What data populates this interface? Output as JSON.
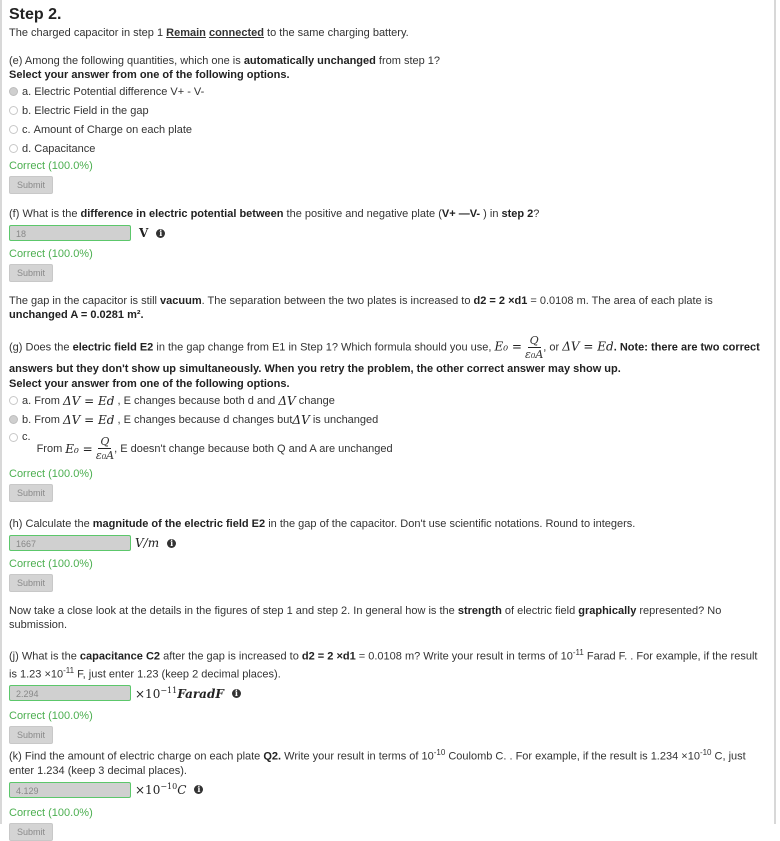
{
  "step": {
    "title": "Step 2.",
    "intro_prefix": "The charged capacitor in step 1 ",
    "intro_remain": "Remain",
    "intro_connected": "connected",
    "intro_suffix": " to the same charging battery."
  },
  "q_e": {
    "prefix": "(e) Among the following quantities, which one is ",
    "bold": "automatically unchanged",
    "suffix": " from step 1?",
    "instruction": "Select your answer from one of the following options.",
    "options": [
      {
        "letter": "a.",
        "text": "Electric Potential difference V+ - V-",
        "checked": true
      },
      {
        "letter": "b.",
        "text": "Electric Field in the gap",
        "checked": false
      },
      {
        "letter": "c.",
        "text": "Amount of Charge on each plate",
        "checked": false
      },
      {
        "letter": "d.",
        "text": "Capacitance",
        "checked": false
      }
    ],
    "status": "Correct (100.0%)",
    "submit_label": "Submit"
  },
  "q_f": {
    "prefix": "(f) What is the ",
    "bold1": "difference in electric potential between",
    "middle": " the positive and negative plate (",
    "bold2": "V+ —V-",
    "middle2": " ) in ",
    "bold3": "step 2",
    "suffix": "?",
    "value": "18",
    "unit": "V",
    "status": "Correct (100.0%)",
    "submit_label": "Submit"
  },
  "info_gap": {
    "t1": "The gap in the capacitor is still ",
    "b1": "vacuum",
    "t2": ". The separation between the two plates is increased to ",
    "b2": "d2 = 2 ×d1",
    "t3": " = 0.0108 m. The area of each plate is ",
    "b3": "unchanged A = 0.0281 m²."
  },
  "q_g": {
    "prefix": "(g) Does the ",
    "bold1": "electric field E2",
    "middle": " in the gap change from E1 in Step 1? Which formula should you use, ",
    "formula1_lhs": "E₀ =",
    "formula1_num": "Q",
    "formula1_den": "ε₀A",
    "or_text": ", or ",
    "formula2": "ΔV = Ed",
    "note": ". Note: there are two correct answers but they don't show up simultaneously. When you retry the problem, the other correct answer may show up.",
    "instruction": "Select your answer from one of the following options.",
    "options": [
      {
        "letter": "a.",
        "from": "From",
        "formula": "ΔV = Ed",
        "text": ", E changes because both d and ",
        "formula_b": "ΔV",
        "text2": " change",
        "checked": false
      },
      {
        "letter": "b.",
        "from": "From",
        "formula": "ΔV = Ed",
        "text": ", E changes because d changes but ",
        "formula_b": "ΔV",
        "text2": " is unchanged",
        "checked": true
      },
      {
        "letter": "c.",
        "from": "From",
        "formula_lhs": "E₀ =",
        "formula_num": "Q",
        "formula_den": "ε₀A",
        "text": ", E doesn't change because both Q and A are unchanged",
        "checked": false
      }
    ],
    "status": "Correct (100.0%)",
    "submit_label": "Submit"
  },
  "q_h": {
    "prefix": "(h) Calculate the ",
    "bold": "magnitude of the electric field E2",
    "suffix": " in the gap of the capacitor. Don't use scientific notations. Round to integers.",
    "value": "1667",
    "unit": "V/m",
    "status": "Correct (100.0%)",
    "submit_label": "Submit"
  },
  "info_look": {
    "t1": "Now take a close look at the details in the figures of step 1 and step 2. In general how is the ",
    "b1": "strength",
    "t2": " of electric field ",
    "b2": "graphically",
    "t3": " represented? No submission."
  },
  "q_j": {
    "prefix": "(j) What is the ",
    "bold1": "capacitance C2",
    "middle": " after the gap is increased to ",
    "bold2": "d2 = 2 ×d1",
    "middle2": " = 0.0108 m? Write your result in terms of 10",
    "exp1": "-11",
    "middle3": " Farad F. . For example, if the result is 1.23 ×10",
    "exp2": "-11",
    "suffix": " F, just enter 1.23 (keep 2 decimal places).",
    "value": "2.294",
    "unit_prefix": "×10",
    "unit_exp": "−11",
    "unit_suffix": "FaradF",
    "status": "Correct (100.0%)",
    "submit_label": "Submit"
  },
  "q_k": {
    "prefix": "(k) Find the amount of electric charge on each plate ",
    "bold1": "Q2.",
    "middle": "  Write your result in terms of 10",
    "exp1": "-10",
    "middle2": " Coulomb C. . For example, if the result is 1.234 ×10",
    "exp2": "-10",
    "suffix": " C, just enter 1.234 (keep 3 decimal places).",
    "value": "4.129",
    "unit_prefix": "×10",
    "unit_exp": "−10",
    "unit_suffix": "C",
    "status": "Correct (100.0%)",
    "submit_label": "Submit"
  }
}
